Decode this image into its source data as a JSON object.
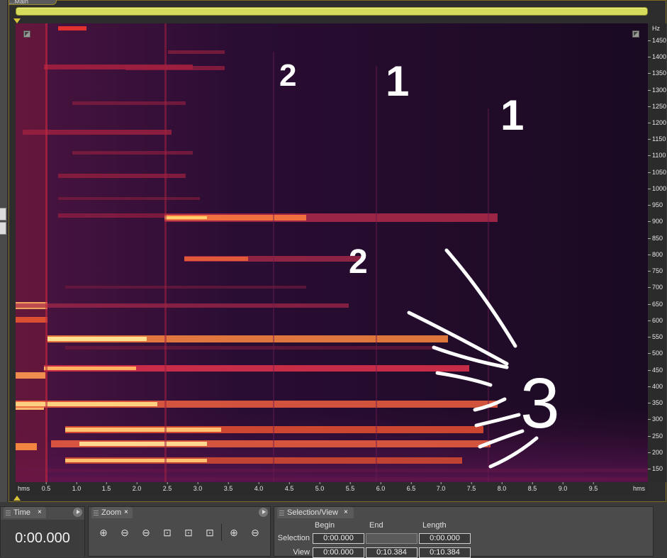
{
  "editor_tab": {
    "label": "...Main"
  },
  "frequency_axis": {
    "unit": "Hz",
    "labels": [
      "1450",
      "1400",
      "1350",
      "1300",
      "1250",
      "1200",
      "1150",
      "1100",
      "1050",
      "1000",
      "950",
      "900",
      "850",
      "800",
      "750",
      "700",
      "650",
      "600",
      "550",
      "500",
      "450",
      "400",
      "350",
      "300",
      "250",
      "200",
      "150"
    ]
  },
  "time_axis": {
    "unit_left": "hms",
    "unit_right": "hms",
    "labels": [
      "0.5",
      "1.0",
      "1.5",
      "2.0",
      "2.5",
      "3.0",
      "3.5",
      "4.0",
      "4.5",
      "5.0",
      "5.5",
      "6.0",
      "6.5",
      "7.0",
      "7.5",
      "8.0",
      "8.5",
      "9.0",
      "9.5"
    ]
  },
  "annotations": {
    "a1": "2",
    "a2": "1",
    "a3": "1",
    "a4": "2",
    "a5": "3"
  },
  "time_panel": {
    "title": "Time",
    "close": "×",
    "value": "0:00.000"
  },
  "zoom_panel": {
    "title": "Zoom",
    "close": "×",
    "buttons": [
      "zoom-in-amplitude",
      "zoom-out-amplitude",
      "zoom-out-full",
      "zoom-to-selection",
      "zoom-selection-left",
      "zoom-selection-right",
      "zoom-in-time",
      "zoom-out-time"
    ]
  },
  "selection_panel": {
    "title": "Selection/View",
    "close": "×",
    "headers": {
      "begin": "Begin",
      "end": "End",
      "length": "Length"
    },
    "selection": {
      "label": "Selection",
      "begin": "0:00.000",
      "end": "",
      "length": "0:00.000"
    },
    "view": {
      "label": "View",
      "begin": "0:00.000",
      "end": "0:10.384",
      "length": "0:10.384"
    }
  },
  "colors": {
    "overview": "#d6dd5c",
    "accent": "#d8c23a",
    "spectrogram_bg": "#1c0a22"
  }
}
